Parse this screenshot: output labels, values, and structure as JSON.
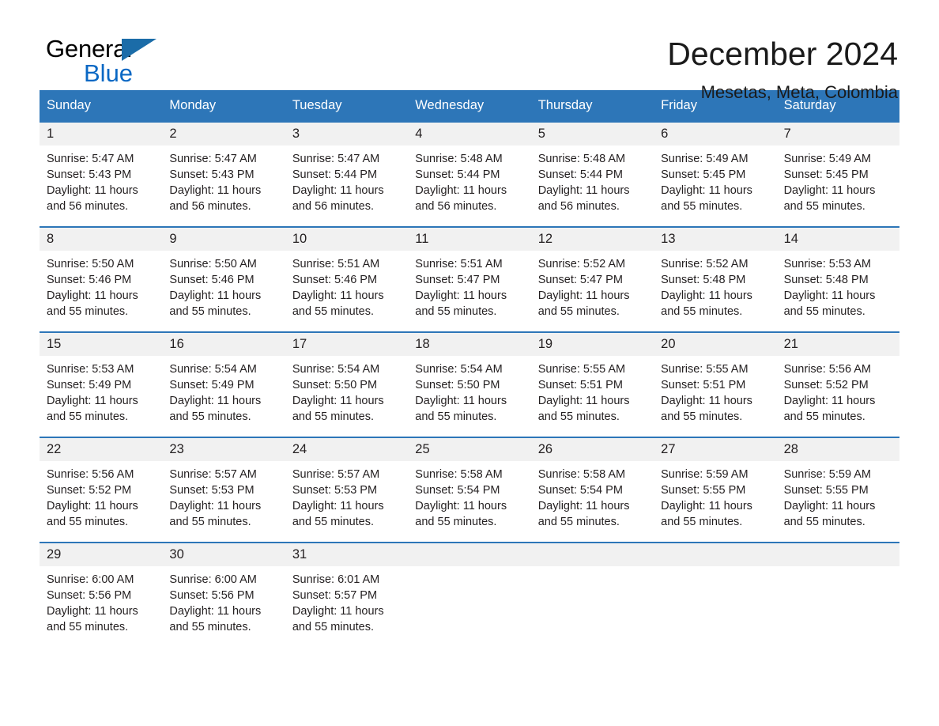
{
  "brand": {
    "name_part1": "General",
    "name_part2": "Blue",
    "accent_color": "#1b6ca8",
    "blue_text_color": "#0a68c4",
    "triangle_icon": "triangle-icon"
  },
  "header": {
    "title": "December 2024",
    "subtitle": "Mesetas, Meta, Colombia"
  },
  "calendar": {
    "header_bg": "#2d76b8",
    "date_band_bg": "#f1f1f1",
    "weekdays": [
      "Sunday",
      "Monday",
      "Tuesday",
      "Wednesday",
      "Thursday",
      "Friday",
      "Saturday"
    ],
    "weeks": [
      {
        "days": [
          {
            "num": "1",
            "sunrise": "Sunrise: 5:47 AM",
            "sunset": "Sunset: 5:43 PM",
            "daylight": "Daylight: 11 hours and 56 minutes."
          },
          {
            "num": "2",
            "sunrise": "Sunrise: 5:47 AM",
            "sunset": "Sunset: 5:43 PM",
            "daylight": "Daylight: 11 hours and 56 minutes."
          },
          {
            "num": "3",
            "sunrise": "Sunrise: 5:47 AM",
            "sunset": "Sunset: 5:44 PM",
            "daylight": "Daylight: 11 hours and 56 minutes."
          },
          {
            "num": "4",
            "sunrise": "Sunrise: 5:48 AM",
            "sunset": "Sunset: 5:44 PM",
            "daylight": "Daylight: 11 hours and 56 minutes."
          },
          {
            "num": "5",
            "sunrise": "Sunrise: 5:48 AM",
            "sunset": "Sunset: 5:44 PM",
            "daylight": "Daylight: 11 hours and 56 minutes."
          },
          {
            "num": "6",
            "sunrise": "Sunrise: 5:49 AM",
            "sunset": "Sunset: 5:45 PM",
            "daylight": "Daylight: 11 hours and 55 minutes."
          },
          {
            "num": "7",
            "sunrise": "Sunrise: 5:49 AM",
            "sunset": "Sunset: 5:45 PM",
            "daylight": "Daylight: 11 hours and 55 minutes."
          }
        ]
      },
      {
        "days": [
          {
            "num": "8",
            "sunrise": "Sunrise: 5:50 AM",
            "sunset": "Sunset: 5:46 PM",
            "daylight": "Daylight: 11 hours and 55 minutes."
          },
          {
            "num": "9",
            "sunrise": "Sunrise: 5:50 AM",
            "sunset": "Sunset: 5:46 PM",
            "daylight": "Daylight: 11 hours and 55 minutes."
          },
          {
            "num": "10",
            "sunrise": "Sunrise: 5:51 AM",
            "sunset": "Sunset: 5:46 PM",
            "daylight": "Daylight: 11 hours and 55 minutes."
          },
          {
            "num": "11",
            "sunrise": "Sunrise: 5:51 AM",
            "sunset": "Sunset: 5:47 PM",
            "daylight": "Daylight: 11 hours and 55 minutes."
          },
          {
            "num": "12",
            "sunrise": "Sunrise: 5:52 AM",
            "sunset": "Sunset: 5:47 PM",
            "daylight": "Daylight: 11 hours and 55 minutes."
          },
          {
            "num": "13",
            "sunrise": "Sunrise: 5:52 AM",
            "sunset": "Sunset: 5:48 PM",
            "daylight": "Daylight: 11 hours and 55 minutes."
          },
          {
            "num": "14",
            "sunrise": "Sunrise: 5:53 AM",
            "sunset": "Sunset: 5:48 PM",
            "daylight": "Daylight: 11 hours and 55 minutes."
          }
        ]
      },
      {
        "days": [
          {
            "num": "15",
            "sunrise": "Sunrise: 5:53 AM",
            "sunset": "Sunset: 5:49 PM",
            "daylight": "Daylight: 11 hours and 55 minutes."
          },
          {
            "num": "16",
            "sunrise": "Sunrise: 5:54 AM",
            "sunset": "Sunset: 5:49 PM",
            "daylight": "Daylight: 11 hours and 55 minutes."
          },
          {
            "num": "17",
            "sunrise": "Sunrise: 5:54 AM",
            "sunset": "Sunset: 5:50 PM",
            "daylight": "Daylight: 11 hours and 55 minutes."
          },
          {
            "num": "18",
            "sunrise": "Sunrise: 5:54 AM",
            "sunset": "Sunset: 5:50 PM",
            "daylight": "Daylight: 11 hours and 55 minutes."
          },
          {
            "num": "19",
            "sunrise": "Sunrise: 5:55 AM",
            "sunset": "Sunset: 5:51 PM",
            "daylight": "Daylight: 11 hours and 55 minutes."
          },
          {
            "num": "20",
            "sunrise": "Sunrise: 5:55 AM",
            "sunset": "Sunset: 5:51 PM",
            "daylight": "Daylight: 11 hours and 55 minutes."
          },
          {
            "num": "21",
            "sunrise": "Sunrise: 5:56 AM",
            "sunset": "Sunset: 5:52 PM",
            "daylight": "Daylight: 11 hours and 55 minutes."
          }
        ]
      },
      {
        "days": [
          {
            "num": "22",
            "sunrise": "Sunrise: 5:56 AM",
            "sunset": "Sunset: 5:52 PM",
            "daylight": "Daylight: 11 hours and 55 minutes."
          },
          {
            "num": "23",
            "sunrise": "Sunrise: 5:57 AM",
            "sunset": "Sunset: 5:53 PM",
            "daylight": "Daylight: 11 hours and 55 minutes."
          },
          {
            "num": "24",
            "sunrise": "Sunrise: 5:57 AM",
            "sunset": "Sunset: 5:53 PM",
            "daylight": "Daylight: 11 hours and 55 minutes."
          },
          {
            "num": "25",
            "sunrise": "Sunrise: 5:58 AM",
            "sunset": "Sunset: 5:54 PM",
            "daylight": "Daylight: 11 hours and 55 minutes."
          },
          {
            "num": "26",
            "sunrise": "Sunrise: 5:58 AM",
            "sunset": "Sunset: 5:54 PM",
            "daylight": "Daylight: 11 hours and 55 minutes."
          },
          {
            "num": "27",
            "sunrise": "Sunrise: 5:59 AM",
            "sunset": "Sunset: 5:55 PM",
            "daylight": "Daylight: 11 hours and 55 minutes."
          },
          {
            "num": "28",
            "sunrise": "Sunrise: 5:59 AM",
            "sunset": "Sunset: 5:55 PM",
            "daylight": "Daylight: 11 hours and 55 minutes."
          }
        ]
      },
      {
        "days": [
          {
            "num": "29",
            "sunrise": "Sunrise: 6:00 AM",
            "sunset": "Sunset: 5:56 PM",
            "daylight": "Daylight: 11 hours and 55 minutes."
          },
          {
            "num": "30",
            "sunrise": "Sunrise: 6:00 AM",
            "sunset": "Sunset: 5:56 PM",
            "daylight": "Daylight: 11 hours and 55 minutes."
          },
          {
            "num": "31",
            "sunrise": "Sunrise: 6:01 AM",
            "sunset": "Sunset: 5:57 PM",
            "daylight": "Daylight: 11 hours and 55 minutes."
          },
          {
            "num": "",
            "sunrise": "",
            "sunset": "",
            "daylight": ""
          },
          {
            "num": "",
            "sunrise": "",
            "sunset": "",
            "daylight": ""
          },
          {
            "num": "",
            "sunrise": "",
            "sunset": "",
            "daylight": ""
          },
          {
            "num": "",
            "sunrise": "",
            "sunset": "",
            "daylight": ""
          }
        ]
      }
    ]
  }
}
